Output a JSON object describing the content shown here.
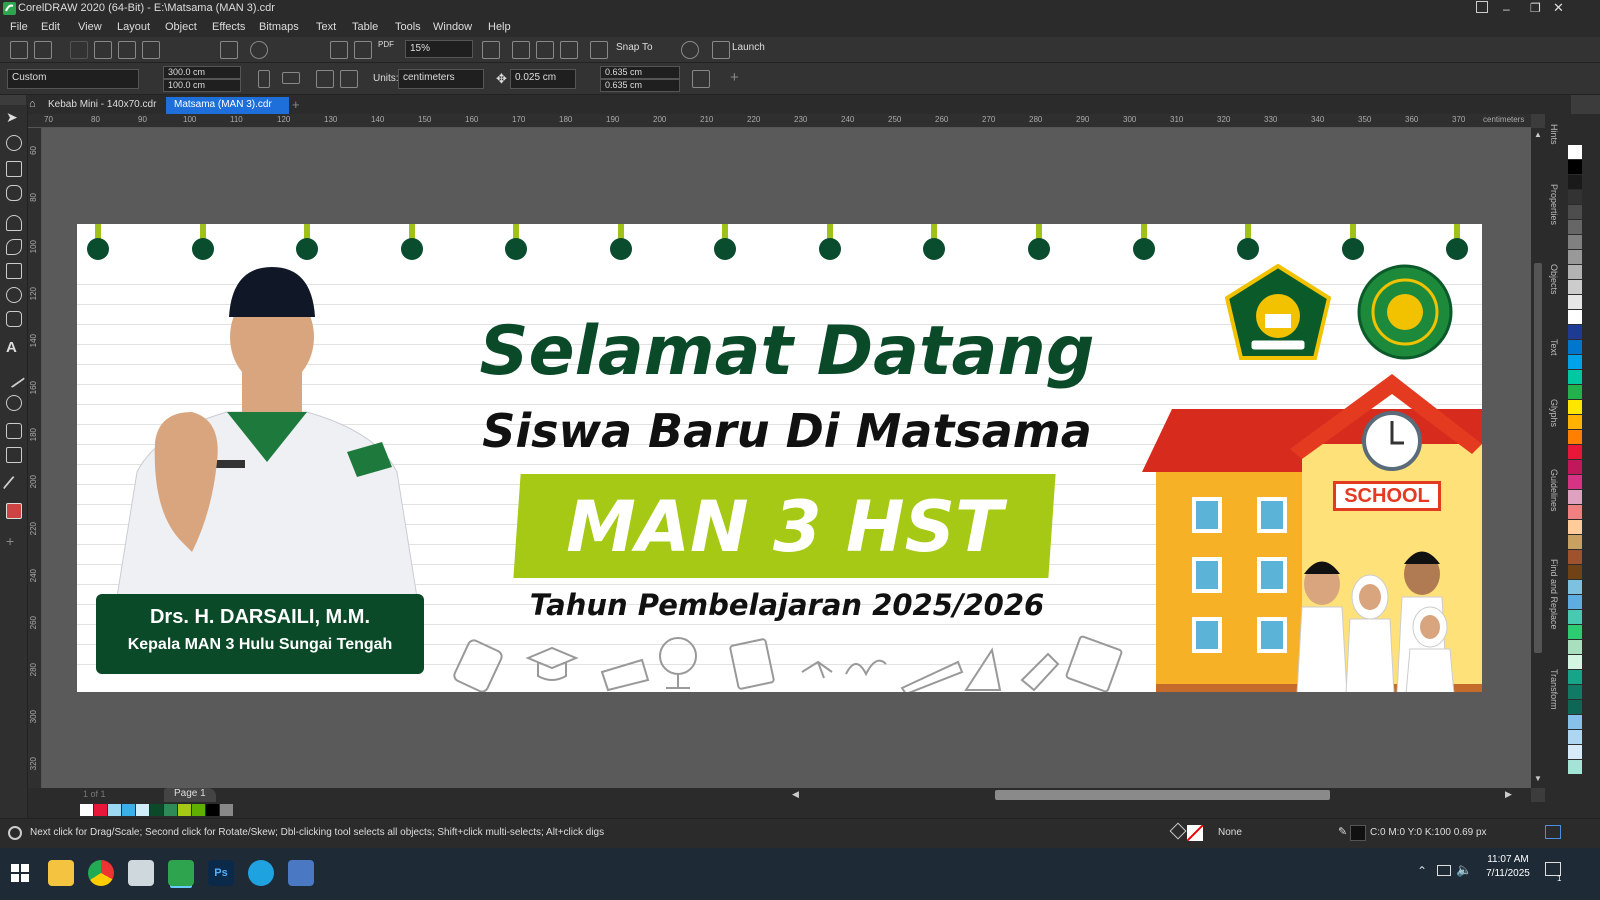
{
  "window": {
    "title": "CorelDRAW 2020 (64-Bit) - E:\\Matsama (MAN 3).cdr"
  },
  "menu": [
    "File",
    "Edit",
    "View",
    "Layout",
    "Object",
    "Effects",
    "Bitmaps",
    "Text",
    "Table",
    "Tools",
    "Window",
    "Help"
  ],
  "toolbar": {
    "zoom": "15%",
    "snap_label": "Snap To",
    "launch_label": "Launch",
    "pdf_label": "PDF"
  },
  "property_bar": {
    "page_preset": "Custom",
    "width": "300.0 cm",
    "height": "100.0 cm",
    "units_label": "Units:",
    "units_value": "centimeters",
    "nudge": "0.025 cm",
    "dup_x": "0.635 cm",
    "dup_y": "0.635 cm"
  },
  "tabs": [
    {
      "label": "Kebab Mini - 140x70.cdr",
      "active": false
    },
    {
      "label": "Matsama (MAN 3).cdr",
      "active": true
    }
  ],
  "ruler": {
    "unit": "centimeters",
    "h_ticks": [
      "70",
      "80",
      "90",
      "100",
      "110",
      "120",
      "130",
      "140",
      "150",
      "160",
      "170",
      "180",
      "190",
      "200",
      "210",
      "220",
      "230",
      "240",
      "250",
      "260",
      "270",
      "280",
      "290",
      "300",
      "310",
      "320",
      "330",
      "340",
      "350",
      "360",
      "370"
    ],
    "v_ticks": [
      "60",
      "80",
      "100",
      "120",
      "140",
      "160",
      "180",
      "200",
      "220",
      "240",
      "260",
      "280",
      "300",
      "320"
    ]
  },
  "banner": {
    "title": "Selamat Datang",
    "subtitle": "Siswa Baru Di Matsama",
    "school": "MAN 3 HST",
    "year": "Tahun Pembelajaran 2025/2026",
    "person_name": "Drs. H. DARSAILI, M.M.",
    "person_role": "Kepala MAN 3 Hulu Sungai Tengah",
    "school_sign": "SCHOOL",
    "colors": {
      "green_dark": "#0b4a28",
      "lime": "#a6c916",
      "red": "#d72b1e",
      "yellow": "#f6b127"
    }
  },
  "dockers": [
    "Hints",
    "Properties",
    "Objects",
    "Text",
    "Glyphs",
    "Guidelines",
    "Find and Replace",
    "Transform"
  ],
  "page_nav": {
    "count": "1 of 1",
    "page_tab": "Page 1"
  },
  "status": {
    "hint": "Next click for Drag/Scale; Second click for Rotate/Skew; Dbl-clicking tool selects all objects; Shift+click multi-selects; Alt+click digs",
    "fill": "None",
    "outline": "C:0 M:0 Y:0 K:100  0.69 px"
  },
  "taskbar": {
    "time": "11:07 AM",
    "date": "7/11/2025",
    "notifications": "1"
  },
  "palette_colors": [
    "#ffffff",
    "#000000",
    "#1a1a1a",
    "#333333",
    "#4d4d4d",
    "#666666",
    "#808080",
    "#999999",
    "#b3b3b3",
    "#cccccc",
    "#e6e6e6",
    "#ffffff",
    "#1f3a93",
    "#0077cc",
    "#00a2e8",
    "#00c8a0",
    "#22b14c",
    "#ffe600",
    "#ffb300",
    "#ff7f00",
    "#e8173a",
    "#c2185b",
    "#d63384",
    "#e0a0c0",
    "#f08080",
    "#ffcc99",
    "#c8a060",
    "#a0522d",
    "#704214",
    "#7cc1e0",
    "#5dade2",
    "#48c9b0",
    "#2ecc71",
    "#a9dfbf",
    "#d5f5e3",
    "#17a589",
    "#117a65",
    "#0e6655",
    "#85c1e9",
    "#aed6f1",
    "#d6eaf8",
    "#a3e4d7"
  ],
  "doc_palette": [
    "#ffffff",
    "#e8173a",
    "#9bd8f2",
    "#3ab0e6",
    "#cfeefa",
    "#0b4a28",
    "#2e8b57",
    "#a6c916",
    "#5fb000",
    "#000000",
    "#888888"
  ]
}
